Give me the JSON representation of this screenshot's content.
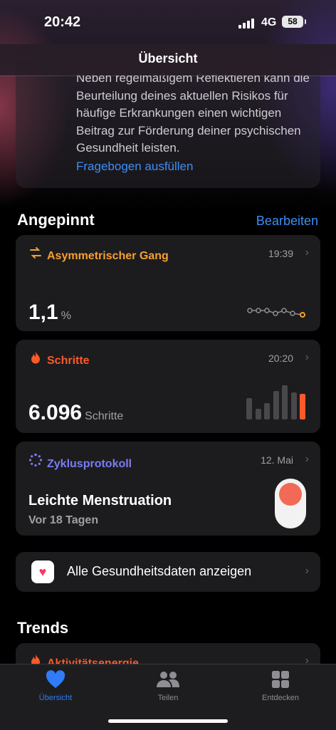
{
  "status": {
    "time": "20:42",
    "network": "4G",
    "battery": "58"
  },
  "nav": {
    "title": "Übersicht"
  },
  "info_card": {
    "text": "Neben regelmäßigem Reflektieren kann die Beurteilung deines aktuellen Risikos für häufige Erkrankungen einen wichtigen Beitrag zur Förderung deiner psychischen Gesundheit leisten.",
    "link": "Fragebogen ausfüllen"
  },
  "pinned": {
    "title": "Angepinnt",
    "edit": "Bearbeiten",
    "cards": [
      {
        "title": "Asymmetrischer Gang",
        "time": "19:39",
        "value": "1,1",
        "unit": "%",
        "icon": "arrows-icon",
        "color": "#f6a02e"
      },
      {
        "title": "Schritte",
        "time": "20:20",
        "value": "6.096",
        "unit": "Schritte",
        "icon": "flame-icon",
        "color": "#fa5a2a"
      },
      {
        "title": "Zyklusprotokoll",
        "time": "12. Mai",
        "value": "Leichte Menstruation",
        "sub": "Vor 18 Tagen",
        "icon": "cycle-icon",
        "color": "#7a7cf4"
      }
    ],
    "steps_bars": [
      0.6,
      0.3,
      0.45,
      0.8,
      0.95,
      0.75,
      0.72
    ]
  },
  "all_data": {
    "label": "Alle Gesundheitsdaten anzeigen"
  },
  "trends": {
    "title": "Trends",
    "first_item": "Aktivitätsenergie"
  },
  "tabbar": [
    {
      "label": "Übersicht",
      "icon": "heart-icon",
      "active": true
    },
    {
      "label": "Teilen",
      "icon": "people-icon",
      "active": false
    },
    {
      "label": "Entdecken",
      "icon": "grid-icon",
      "active": false
    }
  ]
}
